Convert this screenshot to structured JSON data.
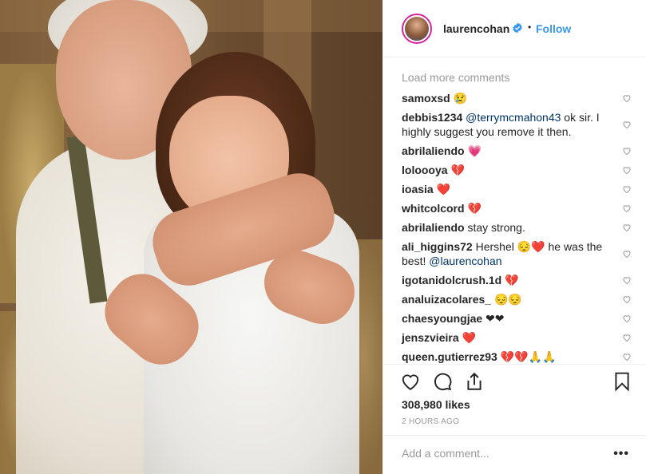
{
  "post": {
    "username": "laurencohan",
    "follow_label": "Follow",
    "separator": "•",
    "verified_icon": "verified-badge-icon"
  },
  "comments": {
    "load_more": "Load more comments",
    "items": [
      {
        "user": "samoxsd",
        "text": "😢",
        "mention": ""
      },
      {
        "user": "debbis1234",
        "mention": "@terrymcmahon43",
        "text": " ok sir. I highly suggest you remove it then."
      },
      {
        "user": "abrilaliendo",
        "text": "💗",
        "mention": ""
      },
      {
        "user": "loloooya",
        "text": "💔",
        "mention": ""
      },
      {
        "user": "ioasia",
        "text": "❤️",
        "mention": ""
      },
      {
        "user": "whitcolcord",
        "text": "💔",
        "mention": ""
      },
      {
        "user": "abrilaliendo",
        "text": "stay strong.",
        "mention": ""
      },
      {
        "user": "ali_higgins72",
        "text": "Hershel 😔❤️ he was the best! ",
        "mention": "@laurencohan"
      },
      {
        "user": "igotanidolcrush.1d",
        "text": "💔",
        "mention": ""
      },
      {
        "user": "analuizacolares_",
        "text": "😔😔",
        "mention": ""
      },
      {
        "user": "chaesyoungjae",
        "text": "❤❤",
        "mention": ""
      },
      {
        "user": "jenszvieira",
        "text": "❤️",
        "mention": ""
      },
      {
        "user": "queen.gutierrez93",
        "text": "💔💔🙏🙏",
        "mention": ""
      }
    ]
  },
  "actions": {
    "like_icon": "heart-icon",
    "comment_icon": "comment-icon",
    "share_icon": "share-icon",
    "save_icon": "bookmark-icon"
  },
  "likes": "308,980 likes",
  "time": "2 HOURS AGO",
  "add_comment": {
    "placeholder": "Add a comment...",
    "more_label": "•••"
  },
  "colors": {
    "link": "#3897f0",
    "mention": "#003569",
    "muted": "#999999",
    "border": "#efefef"
  }
}
